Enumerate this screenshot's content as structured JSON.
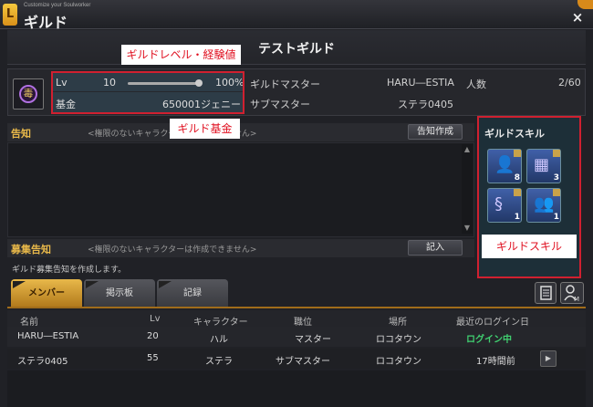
{
  "window": {
    "subtitle": "Customize your Soulworker",
    "title": "ギルド",
    "close": "×"
  },
  "guild": {
    "name": "テストギルド"
  },
  "level": {
    "label": "Lv",
    "value": "10",
    "progress_percent": 100,
    "progress_text": "100%"
  },
  "funds": {
    "label": "基金",
    "value": "650001ジェニー"
  },
  "masters": {
    "master_label": "ギルドマスター",
    "master_value": "HARU―ESTIA",
    "sub_label": "サブマスター",
    "sub_value": "ステラ0405"
  },
  "members_count": {
    "label": "人数",
    "value": "2/60"
  },
  "annotations": {
    "level": "ギルドレベル・経験値",
    "funds": "ギルド基金",
    "skills": "ギルドスキル"
  },
  "notice": {
    "label": "告知",
    "hint": "<権限のないキャラクターは作成できません>",
    "button": "告知作成"
  },
  "recruit": {
    "label": "募集告知",
    "hint": "<権限のないキャラクターは作成できません>",
    "button": "記入",
    "text": "ギルド募集告知を作成します。"
  },
  "skills": {
    "title": "ギルドスキル",
    "items": [
      {
        "icon": "member-plus-icon",
        "level": "8",
        "glyph": "👤"
      },
      {
        "icon": "storage-icon",
        "level": "3",
        "glyph": "▦"
      },
      {
        "icon": "chain-icon",
        "level": "1",
        "glyph": "§"
      },
      {
        "icon": "group-icon",
        "level": "1",
        "glyph": "👥"
      }
    ]
  },
  "tabs": [
    {
      "label": "メンバー"
    },
    {
      "label": "掲示板"
    },
    {
      "label": "記録"
    }
  ],
  "table": {
    "headers": [
      "名前",
      "Lv",
      "キャラクター",
      "職位",
      "場所",
      "最近のログイン日"
    ],
    "rows": [
      [
        "HARU―ESTIA",
        "20",
        "ハル",
        "マスター",
        "ロコタウン",
        "ログイン中"
      ],
      [
        "ステラ0405",
        "55",
        "ステラ",
        "サブマスター",
        "ロコタウン",
        "17時間前"
      ]
    ]
  },
  "colors": {
    "accent": "#e8b84a",
    "online": "#40d070",
    "highlight": "#d02030"
  }
}
